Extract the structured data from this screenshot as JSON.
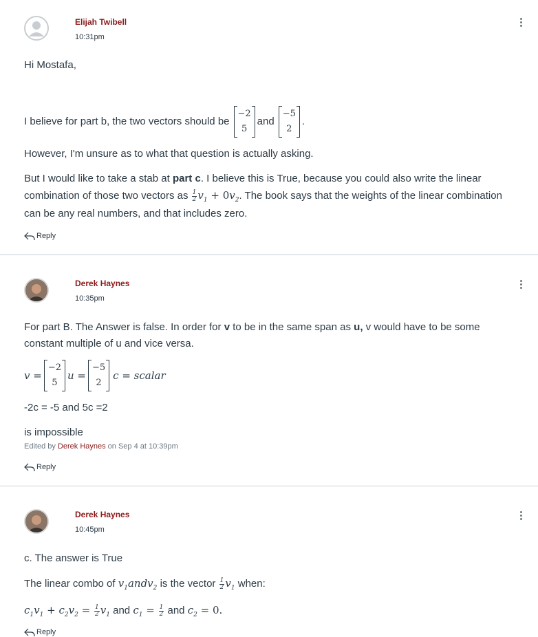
{
  "posts": [
    {
      "author": "Elijah Twibell",
      "time": "10:31pm",
      "greeting": "Hi Mostafa,",
      "line1_pre": "I believe for part b, the two vectors should be",
      "vec_a": [
        "−2",
        "5"
      ],
      "line1_mid": "and",
      "vec_b": [
        "−5",
        "2"
      ],
      "line1_end": ".",
      "line2": "However, I'm unsure as to what that question is actually asking.",
      "line3_pre": "But I would like to take a stab at ",
      "line3_bold": "part c",
      "line3_post": ".  I believe this is True, because you could also write the linear",
      "line4_pre": "combination of those two vectors as",
      "line4_post": ".  The book says that the weights of the linear combination",
      "line5": "can be any real numbers, and that includes zero.",
      "reply": "Reply"
    },
    {
      "author": "Derek Haynes",
      "time": "10:35pm",
      "line1_pre": "For part B.  The Answer is false.  In order for ",
      "line1_bold1": "v",
      "line1_mid": " to be in the same span as ",
      "line1_bold2": "u,",
      "line1_post": "  v would have to be some",
      "line2": "constant multiple of u and vice versa.",
      "eq_v": "v =",
      "eq_u": "u =",
      "eq_c": "c = scalar",
      "vec_v": [
        "−2",
        "5"
      ],
      "vec_u": [
        "−5",
        "2"
      ],
      "line3": "-2c = -5 and 5c =2",
      "line4": "is impossible",
      "edited_pre": "Edited by ",
      "edited_name": "Derek Haynes",
      "edited_post": " on Sep 4 at 10:39pm",
      "reply": "Reply"
    },
    {
      "author": "Derek Haynes",
      "time": "10:45pm",
      "line1": "c. The answer is True",
      "line2_pre": "The linear combo of",
      "line2_math": "v",
      "line2_mid": "is the vector",
      "line2_post": "when:",
      "line3_and1": "and",
      "line3_and2": "and",
      "reply": "Reply"
    }
  ]
}
